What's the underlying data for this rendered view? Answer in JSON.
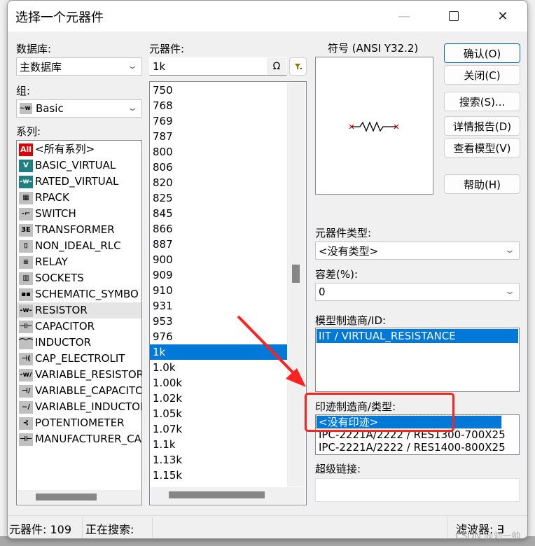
{
  "dialog": {
    "title": "选择一个元器件",
    "window_controls": {
      "minimize": "—",
      "close": "✕"
    }
  },
  "database": {
    "label": "数据库:",
    "value": "主数据库"
  },
  "group": {
    "label": "组:",
    "value": "Basic",
    "icon": "resistor-wave-icon"
  },
  "family": {
    "label": "系列:",
    "items": [
      {
        "label": "<所有系列>",
        "icon": "all-icon",
        "glyph": "All",
        "style": "all"
      },
      {
        "label": "BASIC_VIRTUAL",
        "icon": "basic-virtual-icon",
        "glyph": "V",
        "style": "teal"
      },
      {
        "label": "RATED_VIRTUAL",
        "icon": "rated-virtual-icon",
        "glyph": "-w-",
        "style": "teal"
      },
      {
        "label": "RPACK",
        "icon": "rpack-icon",
        "glyph": "▦",
        "style": ""
      },
      {
        "label": "SWITCH",
        "icon": "switch-icon",
        "glyph": "-⌐",
        "style": ""
      },
      {
        "label": "TRANSFORMER",
        "icon": "transformer-icon",
        "glyph": "3E",
        "style": ""
      },
      {
        "label": "NON_IDEAL_RLC",
        "icon": "non-ideal-rlc-icon",
        "glyph": "⌷",
        "style": ""
      },
      {
        "label": "RELAY",
        "icon": "relay-icon",
        "glyph": "≡",
        "style": ""
      },
      {
        "label": "SOCKETS",
        "icon": "sockets-icon",
        "glyph": "▥",
        "style": ""
      },
      {
        "label": "SCHEMATIC_SYMBO",
        "icon": "schematic-symbol-icon",
        "glyph": "▪▪",
        "style": ""
      },
      {
        "label": "RESISTOR",
        "icon": "resistor-icon",
        "glyph": "-w-",
        "style": ""
      },
      {
        "label": "CAPACITOR",
        "icon": "capacitor-icon",
        "glyph": "⊣⊢",
        "style": ""
      },
      {
        "label": "INDUCTOR",
        "icon": "inductor-icon",
        "glyph": "⌒⌒",
        "style": ""
      },
      {
        "label": "CAP_ELECTROLIT",
        "icon": "cap-electrolytic-icon",
        "glyph": "⊣(",
        "style": ""
      },
      {
        "label": "VARIABLE_RESISTOR",
        "icon": "variable-resistor-icon",
        "glyph": "-w/",
        "style": ""
      },
      {
        "label": "VARIABLE_CAPACITOR",
        "icon": "variable-capacitor-icon",
        "glyph": "⊣/",
        "style": ""
      },
      {
        "label": "VARIABLE_INDUCTOR",
        "icon": "variable-inductor-icon",
        "glyph": "~/",
        "style": ""
      },
      {
        "label": "POTENTIOMETER",
        "icon": "potentiometer-icon",
        "glyph": "⊰",
        "style": ""
      },
      {
        "label": "MANUFACTURER_CAPACITOR",
        "icon": "manufacturer-capacitor-icon",
        "glyph": "⊣⊢",
        "style": ""
      }
    ],
    "hovered_index": 10
  },
  "component": {
    "label": "元器件:",
    "search_value": "1k",
    "omega_button": "Ω",
    "filter_icon": "filter-icon",
    "items": [
      "750",
      "768",
      "769",
      "787",
      "800",
      "806",
      "820",
      "825",
      "845",
      "866",
      "887",
      "900",
      "909",
      "910",
      "931",
      "953",
      "976",
      "1k",
      "1.0k",
      "1.00k",
      "1.02k",
      "1.05k",
      "1.07k",
      "1.1k",
      "1.13k",
      "1.15k"
    ],
    "selected_index": 17
  },
  "symbol": {
    "label": "符号 (ANSI Y32.2)"
  },
  "buttons": {
    "ok": "确认(O)",
    "close": "关闭(C)",
    "search": "搜索(S)...",
    "detail_report": "详情报告(D)",
    "view_model": "查看模型(V)",
    "help": "帮助(H)"
  },
  "component_type": {
    "label": "元器件类型:",
    "value": "<没有类型>"
  },
  "tolerance": {
    "label": "容差(%):",
    "value": "0"
  },
  "model_manufacturer": {
    "label": "模型制造商/ID:",
    "items": [
      "IIT / VIRTUAL_RESISTANCE"
    ],
    "selected_index": 0
  },
  "footprint": {
    "label": "印迹制造商/类型:",
    "items": [
      "<没有印迹>",
      "IPC-2221A/2222 / RES1300-700X25",
      "IPC-2221A/2222 / RES1400-800X25"
    ],
    "selected_index": 0
  },
  "hyperlink": {
    "label": "超级链接:",
    "value": ""
  },
  "status": {
    "components": "元器件:  109",
    "searching": "正在搜索:",
    "filter": "滤波器:  ∃"
  },
  "watermark": "CSDN @刘一帅",
  "colors": {
    "selection": "#0078d7",
    "annotation": "#ff2020",
    "default_button_border": "#0067c0"
  }
}
